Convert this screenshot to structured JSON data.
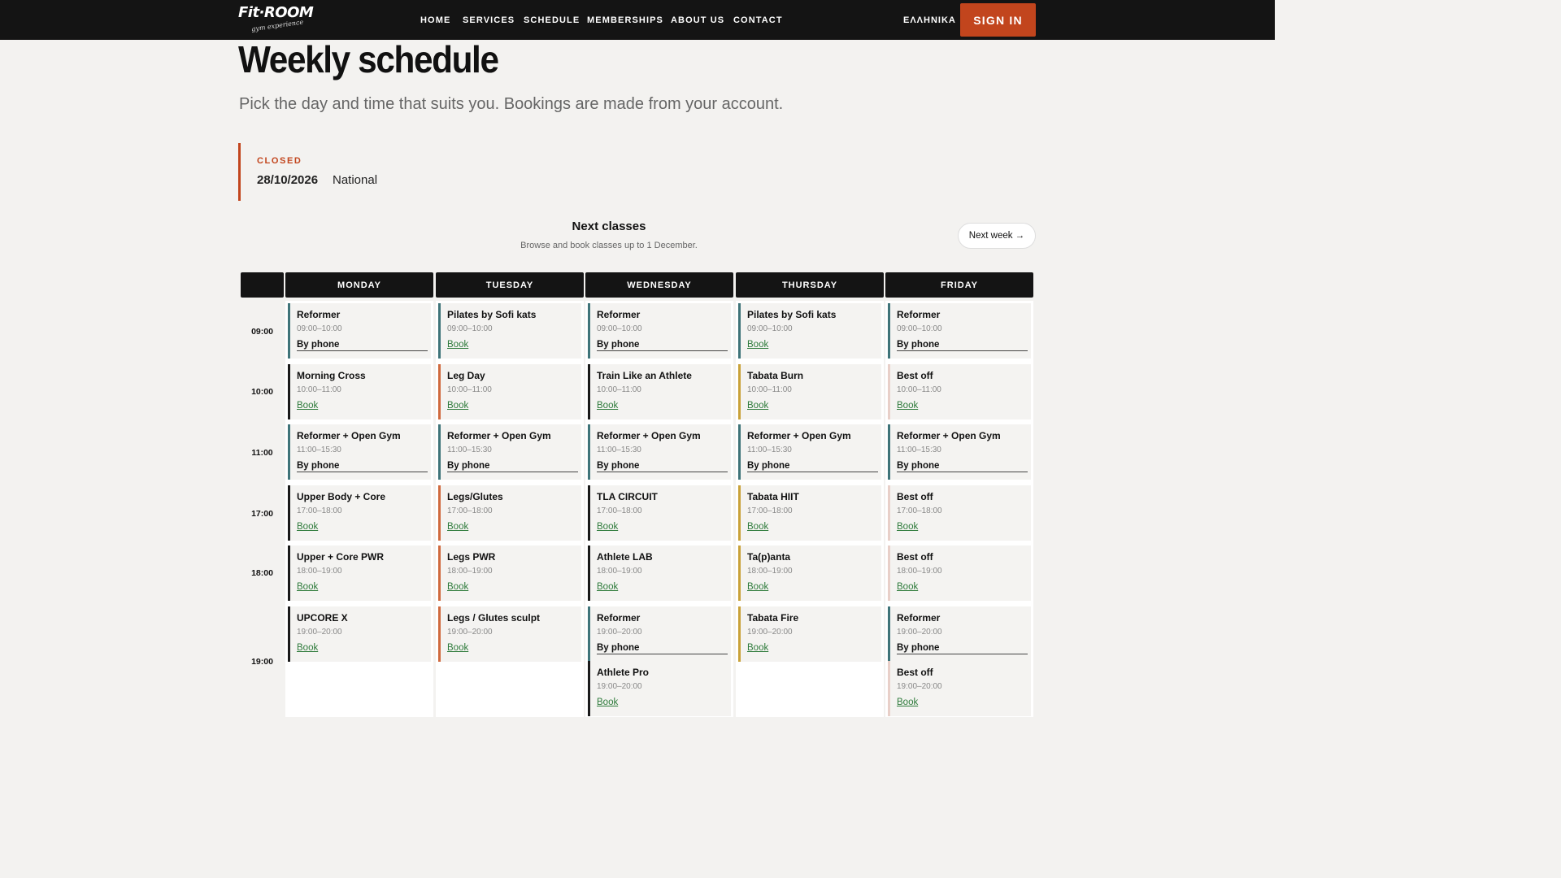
{
  "header": {
    "logo_text": "Fit·ROOM",
    "logo_tagline": "gym experience",
    "nav": [
      "HOME",
      "SERVICES",
      "SCHEDULE",
      "MEMBERSHIPS",
      "ABOUT US",
      "CONTACT"
    ],
    "language": "ΕΛΛΗΝΙΚΑ",
    "sign_in": "SIGN IN"
  },
  "page": {
    "title": "Weekly schedule",
    "subtitle": "Pick the day and time that suits you. Bookings are made from your account."
  },
  "notice": {
    "label": "CLOSED",
    "date": "28/10/2026",
    "description": "National"
  },
  "next_classes": {
    "title": "Next classes",
    "subtitle": "Browse and book classes up to 1 December.",
    "next_week_label": "Next week →"
  },
  "days": [
    "MONDAY",
    "TUESDAY",
    "WEDNESDAY",
    "THURSDAY",
    "FRIDAY"
  ],
  "times": [
    "09:00",
    "10:00",
    "11:00",
    "17:00",
    "18:00",
    "19:00"
  ],
  "colors": {
    "accent": "#c2451d",
    "header_bg": "#141414",
    "book_link": "#2d7a3a",
    "bar_teal": "#3f7479",
    "bar_black": "#1a1a1a",
    "bar_orange": "#d06a3f",
    "bar_mustard": "#c9a23a",
    "bar_pink": "#e8cfc8"
  },
  "schedule": [
    {
      "day": 0,
      "slot": 0,
      "title": "Reformer",
      "time": "09:00–10:00",
      "action": "By phone",
      "bar": "bar_teal"
    },
    {
      "day": 1,
      "slot": 0,
      "title": "Pilates by Sofi kats",
      "time": "09:00–10:00",
      "action": "Book",
      "bar": "bar_teal"
    },
    {
      "day": 2,
      "slot": 0,
      "title": "Reformer",
      "time": "09:00–10:00",
      "action": "By phone",
      "bar": "bar_teal"
    },
    {
      "day": 3,
      "slot": 0,
      "title": "Pilates by Sofi kats",
      "time": "09:00–10:00",
      "action": "Book",
      "bar": "bar_teal"
    },
    {
      "day": 4,
      "slot": 0,
      "title": "Reformer",
      "time": "09:00–10:00",
      "action": "By phone",
      "bar": "bar_teal"
    },
    {
      "day": 0,
      "slot": 1,
      "title": "Morning Cross",
      "time": "10:00–11:00",
      "action": "Book",
      "bar": "bar_black"
    },
    {
      "day": 1,
      "slot": 1,
      "title": "Leg Day",
      "time": "10:00–11:00",
      "action": "Book",
      "bar": "bar_orange"
    },
    {
      "day": 2,
      "slot": 1,
      "title": "Train Like an Athlete",
      "time": "10:00–11:00",
      "action": "Book",
      "bar": "bar_black"
    },
    {
      "day": 3,
      "slot": 1,
      "title": "Tabata Burn",
      "time": "10:00–11:00",
      "action": "Book",
      "bar": "bar_mustard"
    },
    {
      "day": 4,
      "slot": 1,
      "title": "Best off",
      "time": "10:00–11:00",
      "action": "Book",
      "bar": "bar_pink"
    },
    {
      "day": 0,
      "slot": 2,
      "title": "Reformer + Open Gym",
      "time": "11:00–15:30",
      "action": "By phone",
      "bar": "bar_teal"
    },
    {
      "day": 1,
      "slot": 2,
      "title": "Reformer + Open Gym",
      "time": "11:00–15:30",
      "action": "By phone",
      "bar": "bar_teal"
    },
    {
      "day": 2,
      "slot": 2,
      "title": "Reformer + Open Gym",
      "time": "11:00–15:30",
      "action": "By phone",
      "bar": "bar_teal"
    },
    {
      "day": 3,
      "slot": 2,
      "title": "Reformer + Open Gym",
      "time": "11:00–15:30",
      "action": "By phone",
      "bar": "bar_teal"
    },
    {
      "day": 4,
      "slot": 2,
      "title": "Reformer + Open Gym",
      "time": "11:00–15:30",
      "action": "By phone",
      "bar": "bar_teal"
    },
    {
      "day": 0,
      "slot": 3,
      "title": "Upper Body + Core",
      "time": "17:00–18:00",
      "action": "Book",
      "bar": "bar_black"
    },
    {
      "day": 1,
      "slot": 3,
      "title": "Legs/Glutes",
      "time": "17:00–18:00",
      "action": "Book",
      "bar": "bar_orange"
    },
    {
      "day": 2,
      "slot": 3,
      "title": "TLA CIRCUIT",
      "time": "17:00–18:00",
      "action": "Book",
      "bar": "bar_black"
    },
    {
      "day": 3,
      "slot": 3,
      "title": "Tabata HIIT",
      "time": "17:00–18:00",
      "action": "Book",
      "bar": "bar_mustard"
    },
    {
      "day": 4,
      "slot": 3,
      "title": "Best off",
      "time": "17:00–18:00",
      "action": "Book",
      "bar": "bar_pink"
    },
    {
      "day": 0,
      "slot": 4,
      "title": "Upper + Core PWR",
      "time": "18:00–19:00",
      "action": "Book",
      "bar": "bar_black"
    },
    {
      "day": 1,
      "slot": 4,
      "title": "Legs PWR",
      "time": "18:00–19:00",
      "action": "Book",
      "bar": "bar_orange"
    },
    {
      "day": 2,
      "slot": 4,
      "title": "Athlete LAB",
      "time": "18:00–19:00",
      "action": "Book",
      "bar": "bar_black"
    },
    {
      "day": 3,
      "slot": 4,
      "title": "Ta(p)anta",
      "time": "18:00–19:00",
      "action": "Book",
      "bar": "bar_mustard"
    },
    {
      "day": 4,
      "slot": 4,
      "title": "Best off",
      "time": "18:00–19:00",
      "action": "Book",
      "bar": "bar_pink"
    },
    {
      "day": 0,
      "slot": 5,
      "title": "UPCORE X",
      "time": "19:00–20:00",
      "action": "Book",
      "bar": "bar_black"
    },
    {
      "day": 1,
      "slot": 5,
      "title": "Legs / Glutes sculpt",
      "time": "19:00–20:00",
      "action": "Book",
      "bar": "bar_orange"
    },
    {
      "day": 2,
      "slot": 5,
      "title": "Reformer",
      "time": "19:00–20:00",
      "action": "By phone",
      "bar": "bar_teal"
    },
    {
      "day": 3,
      "slot": 5,
      "title": "Tabata Fire",
      "time": "19:00–20:00",
      "action": "Book",
      "bar": "bar_mustard"
    },
    {
      "day": 4,
      "slot": 5,
      "title": "Reformer",
      "time": "19:00–20:00",
      "action": "By phone",
      "bar": "bar_teal"
    },
    {
      "day": 2,
      "slot": 5,
      "title": "Athlete Pro",
      "time": "19:00–20:00",
      "action": "Book",
      "bar": "bar_black"
    },
    {
      "day": 4,
      "slot": 5,
      "title": "Best off",
      "time": "19:00–20:00",
      "action": "Book",
      "bar": "bar_pink"
    }
  ]
}
